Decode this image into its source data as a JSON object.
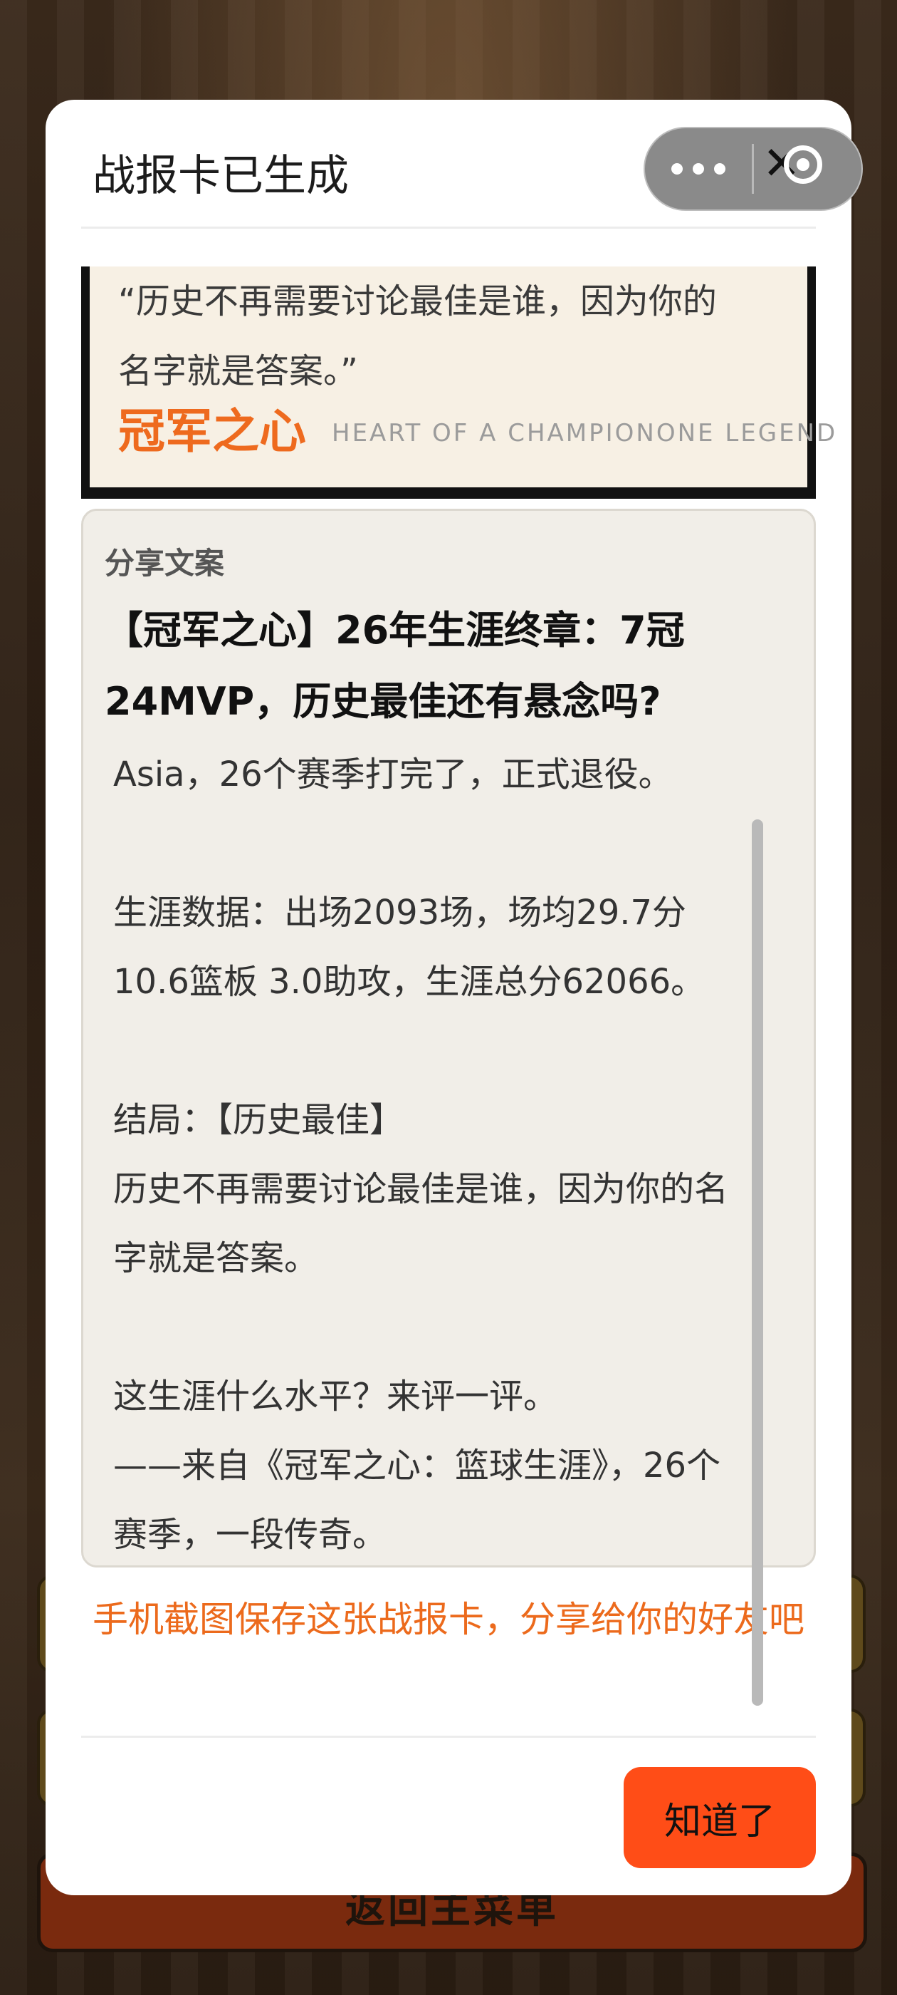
{
  "background": {
    "bottom_button_label": "返回主菜单"
  },
  "modal": {
    "title": "战报卡已生成",
    "capsule": {
      "more_icon": "more-dots-icon",
      "close_icon": "close-icon"
    },
    "card": {
      "quote_line1": "“历史不再需要讨论最佳是谁，因为你的",
      "quote_line2": "名字就是答案。”",
      "brand": "冠军之心",
      "subtitle": "HEART OF A CHAMPIONONE LEGEND"
    },
    "share": {
      "label": "分享文案",
      "title": "【冠军之心】26年生涯终章：7冠24MVP，历史最佳还有悬念吗?",
      "lines": [
        "Asia，26个赛季打完了，正式退役。",
        "",
        "生涯数据：出场2093场，场均29.7分",
        "10.6篮板 3.0助攻，生涯总分62066。",
        "",
        "结局：【历史最佳】",
        "历史不再需要讨论最佳是谁，因为你的名",
        "字就是答案。",
        "",
        "这生涯什么水平？来评一评。",
        "——来自《冠军之心：篮球生涯》，26个",
        "赛季，一段传奇。"
      ]
    },
    "hint": "手机截图保存这张战报卡，分享给你的好友吧",
    "confirm_label": "知道了"
  }
}
